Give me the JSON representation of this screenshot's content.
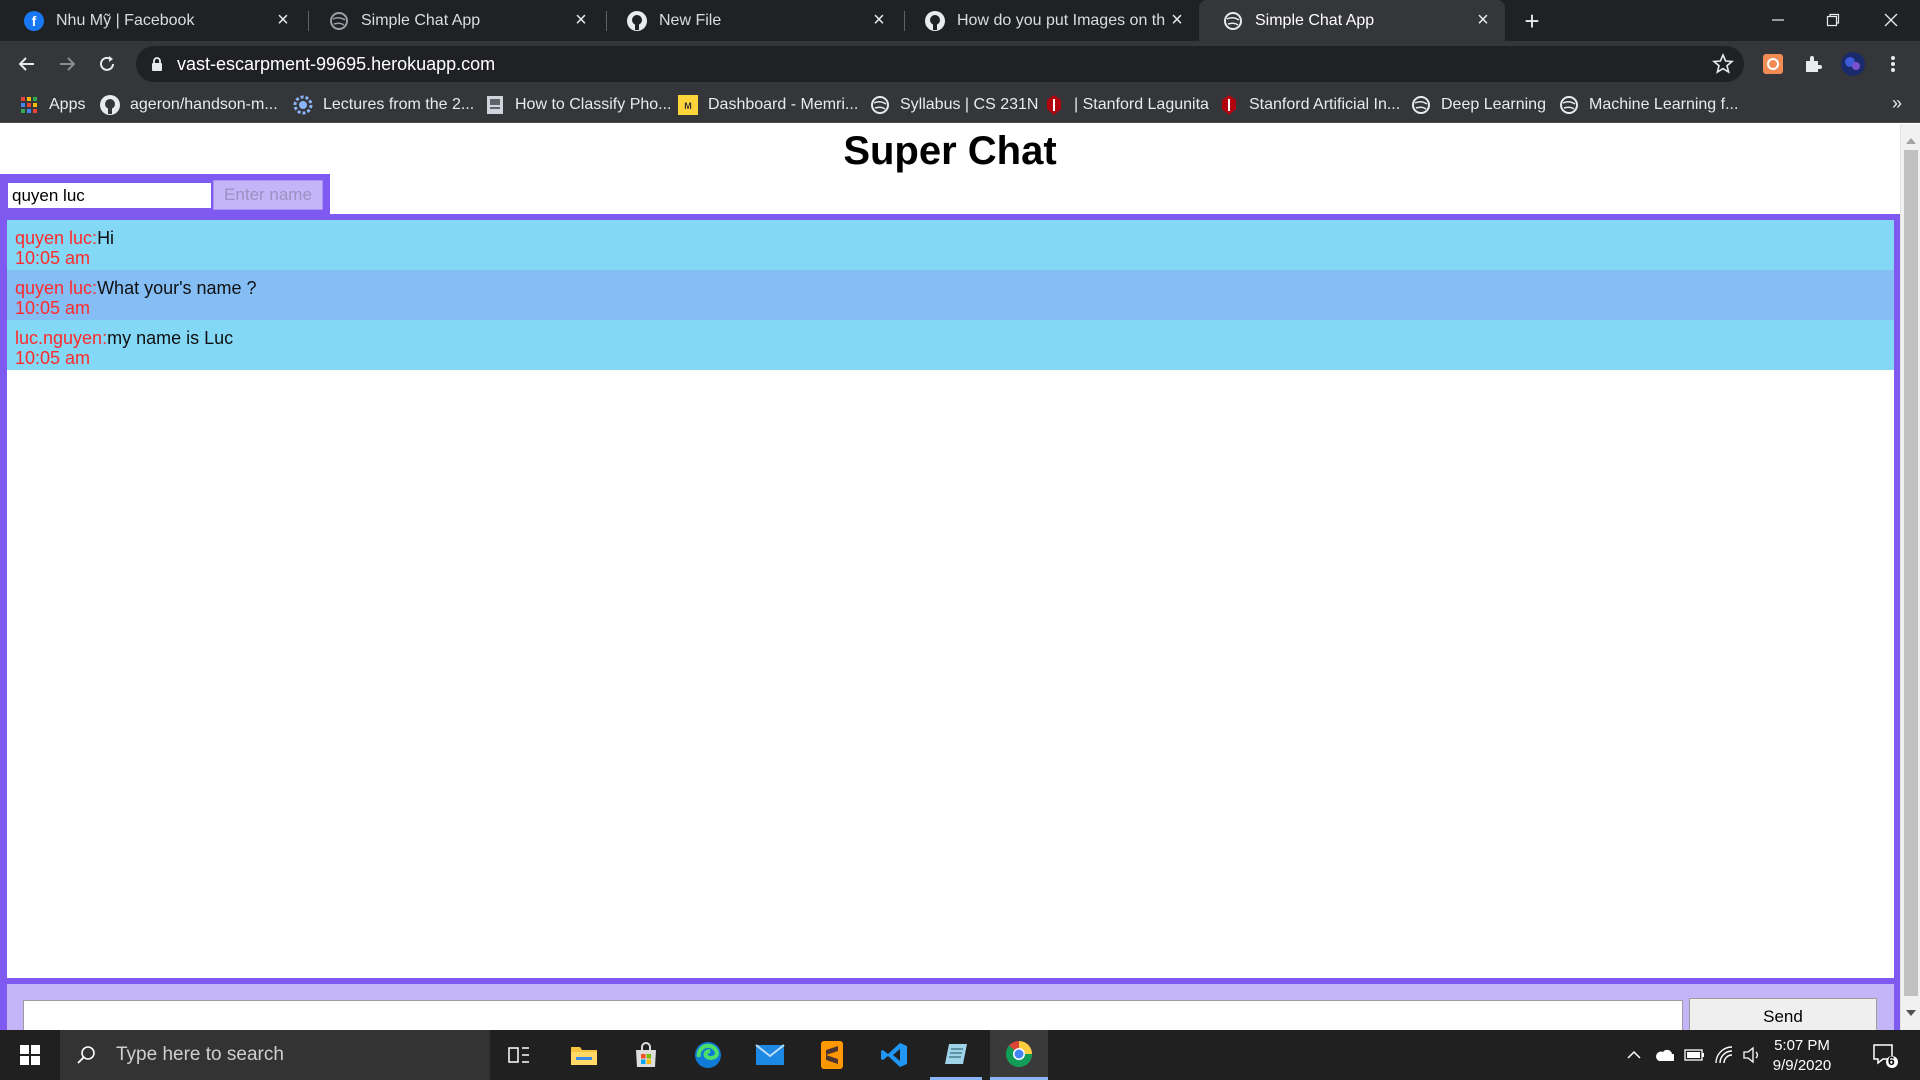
{
  "browser": {
    "tabs": [
      {
        "title": "Nhu Mỹ | Facebook",
        "icon": "facebook-icon"
      },
      {
        "title": "Simple Chat App",
        "icon": "globe-icon"
      },
      {
        "title": "New File",
        "icon": "github-icon"
      },
      {
        "title": "How do you put Images on the R",
        "icon": "github-icon"
      },
      {
        "title": "Simple Chat App",
        "icon": "globe-icon",
        "active": true
      }
    ],
    "address": "vast-escarpment-99695.herokuapp.com",
    "bookmarks": [
      {
        "label": "Apps",
        "icon": "apps-grid-icon"
      },
      {
        "label": "ageron/handson-m...",
        "icon": "github-icon"
      },
      {
        "label": "Lectures from the 2...",
        "icon": "gear-globe-icon"
      },
      {
        "label": "How to Classify Pho...",
        "icon": "document-icon"
      },
      {
        "label": "Dashboard - Memri...",
        "icon": "memrise-icon"
      },
      {
        "label": "Syllabus | CS 231N",
        "icon": "globe-icon"
      },
      {
        "label": "| Stanford Lagunita",
        "icon": "stanford-icon"
      },
      {
        "label": "Stanford Artificial In...",
        "icon": "stanford-icon"
      },
      {
        "label": "Deep Learning",
        "icon": "globe-icon"
      },
      {
        "label": "Machine Learning f...",
        "icon": "globe-icon"
      }
    ],
    "more_bookmarks": "»"
  },
  "app": {
    "title": "Super Chat",
    "name_input_value": "quyen luc",
    "name_button_label": "Enter name",
    "send_button_label": "Send",
    "message_input_value": "",
    "messages": [
      {
        "sender": "quyen luc:",
        "text": "Hi",
        "time": "10:05 am"
      },
      {
        "sender": "quyen luc:",
        "text": "What your's name ?",
        "time": "10:05 am"
      },
      {
        "sender": "luc.nguyen:",
        "text": "my name is Luc",
        "time": "10:05 am"
      }
    ],
    "colors": {
      "frame": "#7f5af0",
      "composer": "#c3b5f8",
      "row_a": "#83d8f5",
      "row_b": "#85bdf5",
      "sender": "#ff2a2a"
    }
  },
  "taskbar": {
    "search_placeholder": "Type here to search",
    "apps": [
      "task-view-icon",
      "file-explorer-icon",
      "store-icon",
      "edge-icon",
      "mail-icon",
      "sublime-text-icon",
      "vscode-icon",
      "notepad-icon",
      "chrome-icon"
    ],
    "time": "5:07 PM",
    "date": "9/9/2020",
    "notifications": "6"
  }
}
